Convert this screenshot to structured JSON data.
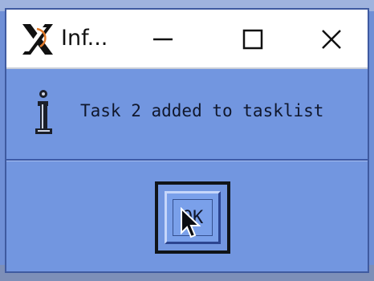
{
  "window": {
    "title": "Inf...",
    "app_icon": "x-window-system-icon",
    "controls": {
      "minimize_icon": "minimize-icon",
      "maximize_icon": "maximize-icon",
      "close_icon": "close-icon"
    }
  },
  "dialog": {
    "icon": "info-icon",
    "message": "Task 2 added to tasklist",
    "ok_label": "OK"
  },
  "pointer": {
    "icon": "mouse-cursor-icon"
  },
  "colors": {
    "dialog_background": "#7296e0",
    "titlebar_background": "#ffffff",
    "focus_ring": "#101418"
  }
}
